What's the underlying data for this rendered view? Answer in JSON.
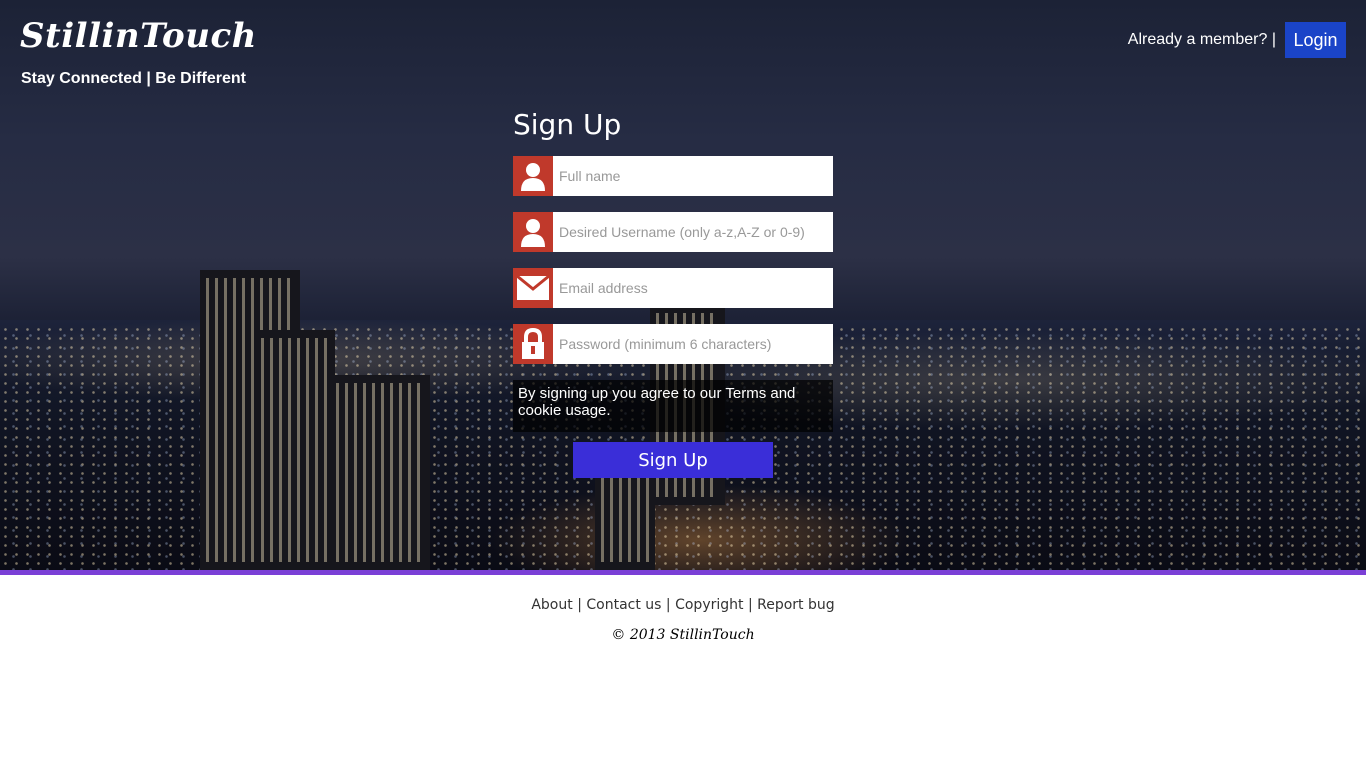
{
  "header": {
    "brand": "StillinTouch",
    "tagline": "Stay Connected | Be Different",
    "member_prompt": "Already a member? |",
    "login_label": "Login"
  },
  "signup": {
    "title": "Sign Up",
    "fields": [
      {
        "placeholder": "Full name",
        "icon": "user-icon"
      },
      {
        "placeholder": "Desired Username (only a-z,A-Z or 0-9)",
        "icon": "user-icon"
      },
      {
        "placeholder": "Email address",
        "icon": "mail-icon"
      },
      {
        "placeholder": "Password (minimum 6 characters)",
        "icon": "lock-icon"
      }
    ],
    "terms": "By signing up you agree to our Terms and cookie usage.",
    "submit_label": "Sign Up"
  },
  "footer": {
    "links": [
      "About",
      "Contact us",
      "Copyright",
      "Report bug"
    ],
    "separator": " | ",
    "copyright": "© 2013 StillinTouch"
  },
  "colors": {
    "icon_bg": "#c0392b",
    "login_bg": "#1a44c8",
    "signup_bg": "#3a2ed8",
    "divider": "#7a3fd6"
  }
}
